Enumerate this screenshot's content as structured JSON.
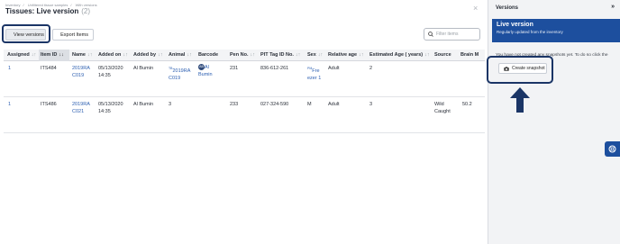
{
  "breadcrumb": [
    "Inventory",
    "Unfiltered tissue samples",
    "With versions"
  ],
  "page": {
    "title": "Tissues: Live version",
    "count": "(2)"
  },
  "toolbar": {
    "view_versions": "View versions",
    "export_items": "Export Items"
  },
  "filter": {
    "placeholder": "Filter items"
  },
  "table": {
    "columns": [
      "Assigned",
      "Item ID",
      "Name",
      "Added on",
      "Added by",
      "Animal",
      "Barcode",
      "Pen No.",
      "PIT Tag ID No.",
      "Sex",
      "Relative age",
      "Estimated Age ( years)",
      "Source",
      "Brain M"
    ],
    "rows": [
      {
        "assigned": "1",
        "item_id": "ITS484",
        "name1": "2019RA",
        "name2": "C019",
        "added_on1": "05/13/2020",
        "added_on2": "14:35",
        "added_by": "Al Bumin",
        "animal1": "2019RA",
        "animal_prefix": "TB",
        "animal2": "C019",
        "barcode_initials": "AB",
        "barcode1": "Al",
        "barcode2": "Bumin",
        "pen": "231",
        "pit": "836-612-261",
        "sex_prefix": "PM",
        "sex1": "Fre",
        "sex2": "ezer 1",
        "rel_age": "Adult",
        "est_age": "2",
        "source": "",
        "brain": ""
      },
      {
        "assigned": "1",
        "item_id": "ITS486",
        "name1": "2019RA",
        "name2": "C021",
        "added_on1": "05/13/2020",
        "added_on2": "14:35",
        "added_by": "Al Bumin",
        "animal1": "3",
        "pen": "233",
        "pit": "027-324-590",
        "sex1": "M",
        "rel_age": "Adult",
        "est_age": "3",
        "source1": "Wild",
        "source2": "Caught",
        "brain": "50.2"
      }
    ]
  },
  "versions_panel": {
    "title": "Versions",
    "collapse": "»",
    "live_title": "Live version",
    "live_sub": "Regularly updated from the inventory",
    "no_snapshots": "You have not created any snapshots yet. To do so click the",
    "create_snapshot": "Create snapshot"
  },
  "colors": {
    "accent": "#1d4f9e",
    "highlight": "#1b3566",
    "link": "#2a5db0"
  }
}
